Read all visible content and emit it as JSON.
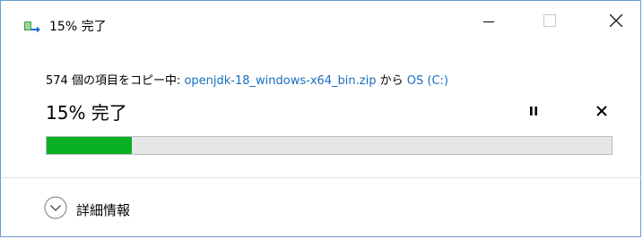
{
  "window": {
    "title": "15% 完了",
    "controls": {
      "minimize_icon": "minimize-icon",
      "maximize_icon": "maximize-icon",
      "close_icon": "close-icon"
    }
  },
  "copy_status": {
    "prefix": "574 個の項目をコピー中: ",
    "source": "openjdk-18_windows-x64_bin.zip",
    "middle": " から ",
    "destination": "OS (C:)",
    "percent_title": "15% 完了"
  },
  "progress": {
    "percent": 15,
    "fill_color": "#06b025",
    "track_color": "#e6e6e6"
  },
  "actions": {
    "pause_icon": "pause-icon",
    "cancel_icon": "cancel-icon"
  },
  "details": {
    "label": "詳細情報",
    "icon": "chevron-down-circle-icon"
  },
  "colors": {
    "link": "#1a6fc2",
    "window_border": "#6b9bd1"
  }
}
